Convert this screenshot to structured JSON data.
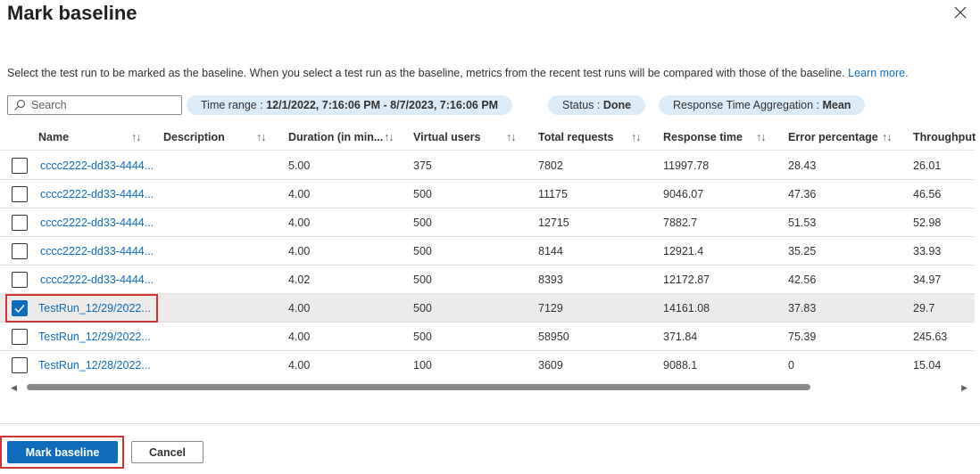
{
  "dialog": {
    "title": "Mark baseline",
    "description": "Select the test run to be marked as the baseline. When you select a test run as the baseline, metrics from the recent test runs will be compared with those of the baseline.",
    "learn_more": "Learn more."
  },
  "toolbar": {
    "search_placeholder": "Search",
    "time_range_label": "Time range : ",
    "time_range_value": "12/1/2022, 7:16:06 PM - 8/7/2023, 7:16:06 PM",
    "status_label": "Status : ",
    "status_value": "Done",
    "aggregation_label": "Response Time Aggregation : ",
    "aggregation_value": "Mean"
  },
  "table": {
    "sort_icon": "↑↓",
    "columns": {
      "name": "Name",
      "description": "Description",
      "duration": "Duration (in min...",
      "virtual_users": "Virtual users",
      "total_requests": "Total requests",
      "response_time": "Response time",
      "error_percentage": "Error percentage",
      "throughput": "Throughput"
    },
    "rows": [
      {
        "name": "cccc2222-dd33-4444...",
        "description": "",
        "duration": "5.00",
        "virtual_users": "375",
        "total_requests": "7802",
        "response_time": "11997.78",
        "error_percentage": "28.43",
        "throughput": "26.01",
        "checked": false
      },
      {
        "name": "cccc2222-dd33-4444...",
        "description": "",
        "duration": "4.00",
        "virtual_users": "500",
        "total_requests": "11175",
        "response_time": "9046.07",
        "error_percentage": "47.36",
        "throughput": "46.56",
        "checked": false
      },
      {
        "name": "cccc2222-dd33-4444...",
        "description": "",
        "duration": "4.00",
        "virtual_users": "500",
        "total_requests": "12715",
        "response_time": "7882.7",
        "error_percentage": "51.53",
        "throughput": "52.98",
        "checked": false
      },
      {
        "name": "cccc2222-dd33-4444...",
        "description": "",
        "duration": "4.00",
        "virtual_users": "500",
        "total_requests": "8144",
        "response_time": "12921.4",
        "error_percentage": "35.25",
        "throughput": "33.93",
        "checked": false
      },
      {
        "name": "cccc2222-dd33-4444...",
        "description": "",
        "duration": "4.02",
        "virtual_users": "500",
        "total_requests": "8393",
        "response_time": "12172.87",
        "error_percentage": "42.56",
        "throughput": "34.97",
        "checked": false
      },
      {
        "name": "TestRun_12/29/2022...",
        "description": "",
        "duration": "4.00",
        "virtual_users": "500",
        "total_requests": "7129",
        "response_time": "14161.08",
        "error_percentage": "37.83",
        "throughput": "29.7",
        "checked": true
      },
      {
        "name": "TestRun_12/29/2022...",
        "description": "",
        "duration": "4.00",
        "virtual_users": "500",
        "total_requests": "58950",
        "response_time": "371.84",
        "error_percentage": "75.39",
        "throughput": "245.63",
        "checked": false
      },
      {
        "name": "TestRun_12/28/2022...",
        "description": "",
        "duration": "4.00",
        "virtual_users": "100",
        "total_requests": "3609",
        "response_time": "9088.1",
        "error_percentage": "0",
        "throughput": "15.04",
        "checked": false
      }
    ]
  },
  "footer": {
    "primary_label": "Mark baseline",
    "cancel_label": "Cancel"
  },
  "colors": {
    "accent": "#0f6cbd",
    "highlight": "#d13438",
    "pill_bg": "#dcebf8",
    "selected_row": "#edebe9"
  }
}
